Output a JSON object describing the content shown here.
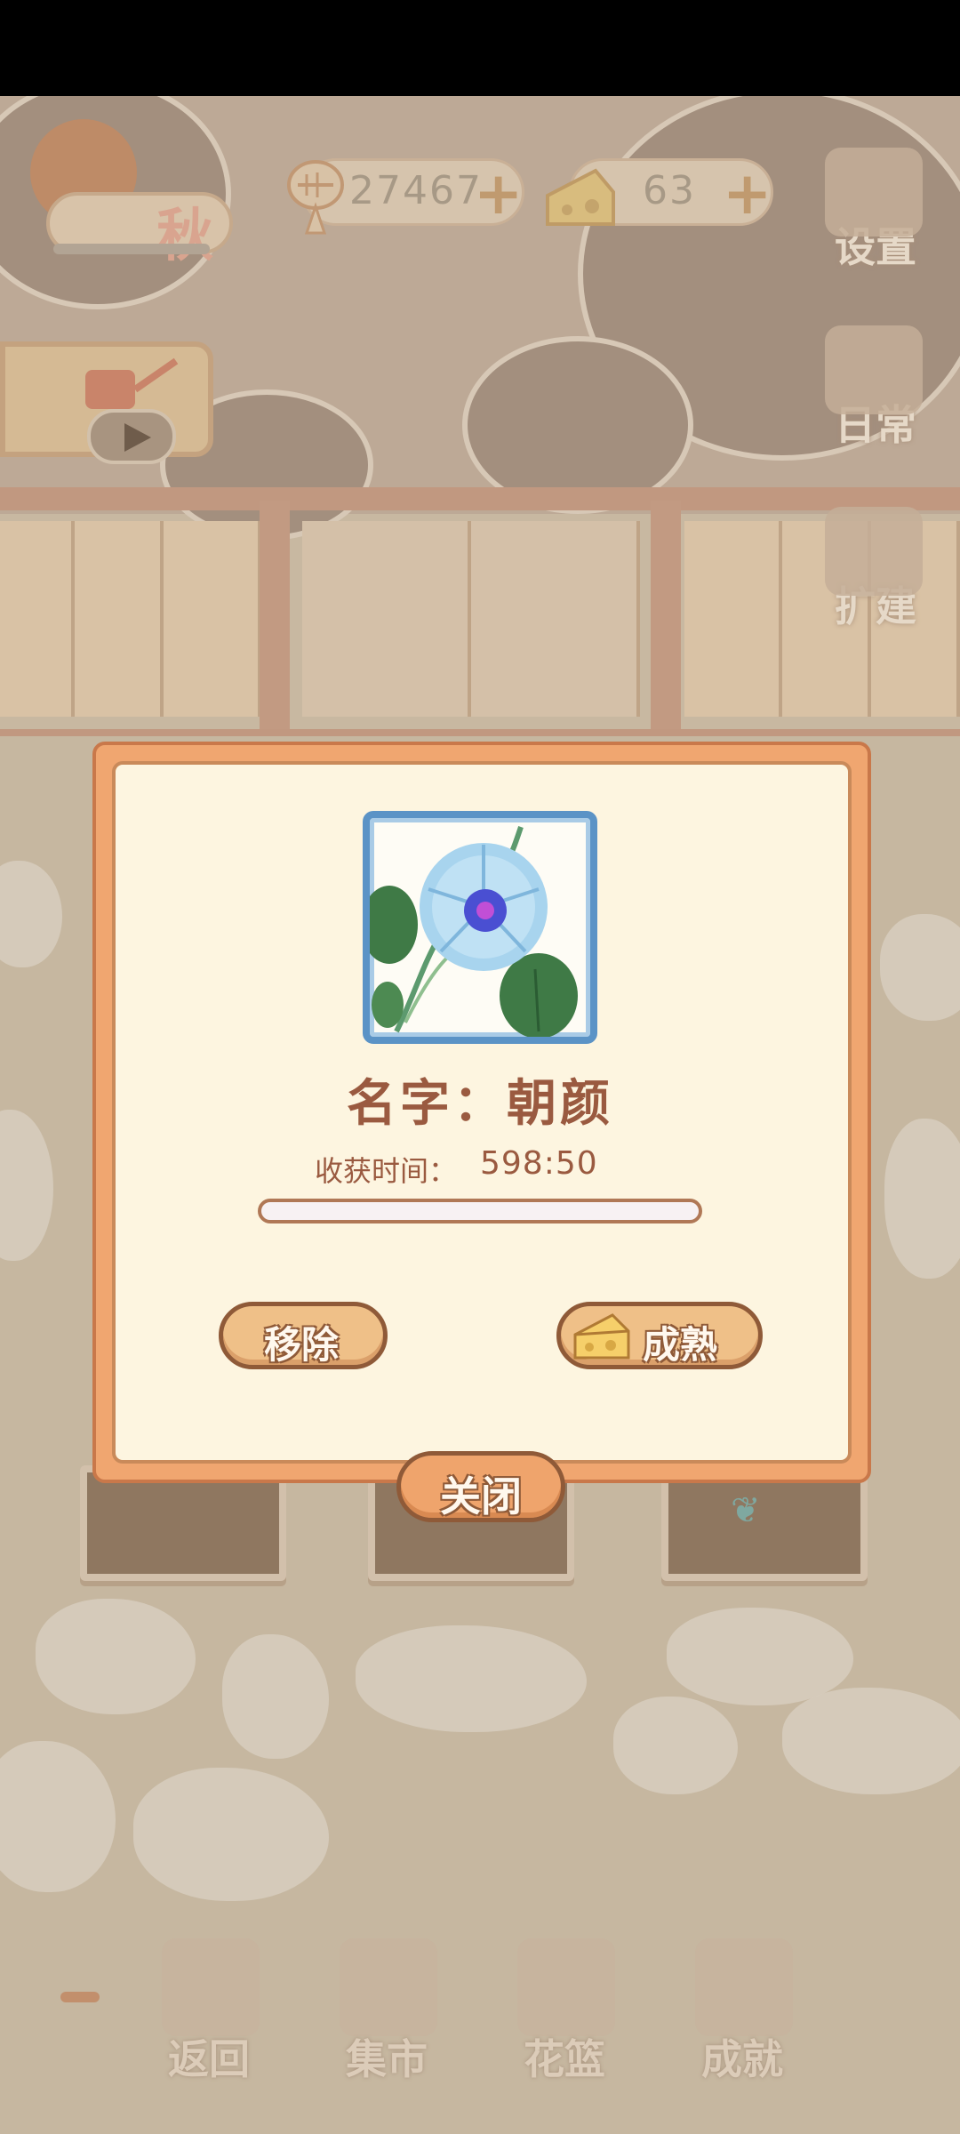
{
  "hud": {
    "season_label": "秋",
    "level_progress": 0.6,
    "fish_currency": "27467",
    "cheese_currency": "63",
    "plus_symbol": "+"
  },
  "side_menu": [
    {
      "label": "设置",
      "icon": "gear-icon"
    },
    {
      "label": "日常",
      "icon": "daily-tasks-icon"
    },
    {
      "label": "扩建",
      "icon": "expand-build-icon"
    }
  ],
  "watering_ad": {
    "icon": "watering-can-icon",
    "play_icon": "play-icon"
  },
  "bottom_nav": [
    {
      "label": "返回",
      "icon": "window-icon"
    },
    {
      "label": "集市",
      "icon": "market-stall-icon"
    },
    {
      "label": "花篮",
      "icon": "flower-basket-icon"
    },
    {
      "label": "成就",
      "icon": "trophy-icon"
    }
  ],
  "dialog": {
    "plant_image": "morning-glory-flower",
    "name_text": "名字：朝颜",
    "harvest_label": "收获时间：",
    "harvest_time": "598:50",
    "growth_progress": 0,
    "remove_label": "移除",
    "mature_label": "成熟",
    "close_label": "关闭"
  },
  "colors": {
    "dialog_frame": "#f0a670",
    "dialog_fill": "#fdf5e0",
    "text_brown": "#9a5a40",
    "plant_frame_blue": "#5b93c6",
    "button_fill": "#efc088",
    "button_border": "#8f5a38"
  }
}
